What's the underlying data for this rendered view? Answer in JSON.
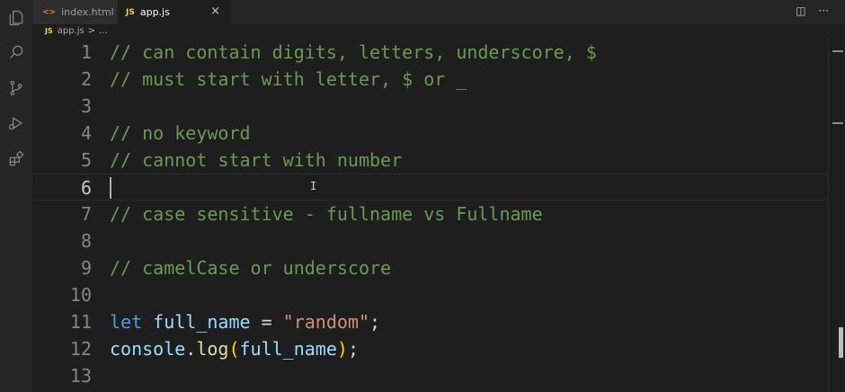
{
  "tabs": [
    {
      "label": "index.html",
      "icon": "html-file-icon",
      "active": false
    },
    {
      "label": "app.js",
      "icon": "JS",
      "active": true
    }
  ],
  "tab_close_glyph": "×",
  "top_actions": [
    {
      "name": "split-editor-icon",
      "glyph": "◫"
    },
    {
      "name": "more-actions-icon",
      "glyph": "···"
    }
  ],
  "breadcrumb": {
    "file_icon": "JS",
    "file": "app.js",
    "separator": ">",
    "rest": "..."
  },
  "line_numbers": [
    "1",
    "2",
    "3",
    "4",
    "5",
    "6",
    "7",
    "8",
    "9",
    "10",
    "11",
    "12",
    "13"
  ],
  "code": {
    "l1": "// can contain digits, letters, underscore, $",
    "l2": "// must start with letter, $ or _",
    "l4": "// no keyword",
    "l5": "// cannot start with number",
    "l7": "// case sensitive - fullname vs Fullname",
    "l9": "// camelCase or underscore",
    "l11": {
      "kw": "let",
      "var": "full_name",
      "op": " = ",
      "str": "\"random\"",
      "end": ";"
    },
    "l12": {
      "obj": "console",
      "dot": ".",
      "fn": "log",
      "open": "(",
      "arg": "full_name",
      "close": ")",
      "end": ";"
    }
  },
  "current_line": 6,
  "colors": {
    "comment": "#6a9955",
    "keyword": "#569cd6",
    "variable": "#9cdcfe",
    "string": "#ce9178",
    "function": "#dcdcaa",
    "editor_bg": "#1e1e1e"
  }
}
